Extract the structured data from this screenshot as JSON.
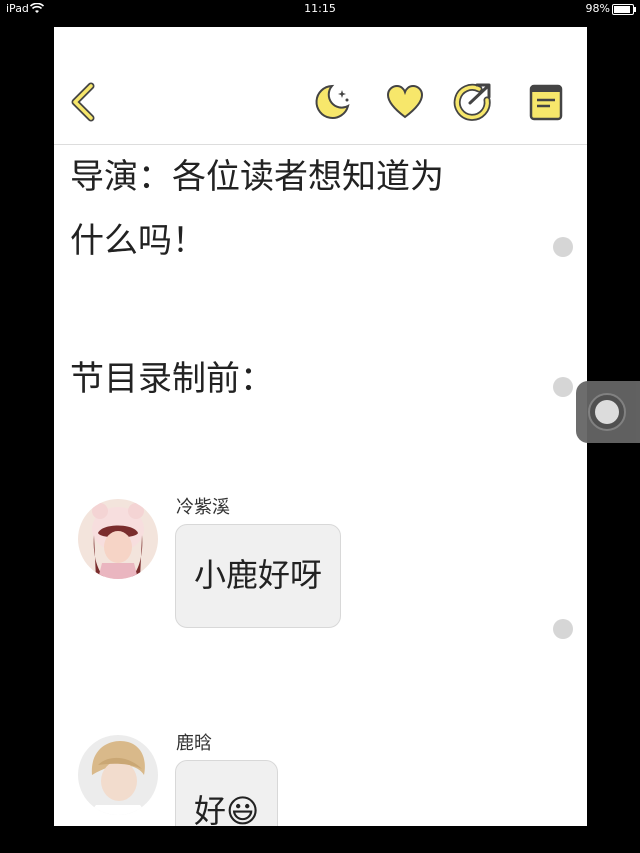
{
  "status_bar": {
    "device": "iPad",
    "time": "11:15",
    "battery": "98%"
  },
  "toolbar": {
    "back_icon": "chevron-left-icon",
    "night_icon": "moon-icon",
    "favorite_icon": "heart-icon",
    "share_icon": "refresh-arrow-icon",
    "catalog_icon": "book-icon",
    "accent_color": "#f7e76b",
    "outline_color": "#444444"
  },
  "story": {
    "paragraphs": [
      "导演：各位读者想知道为",
      "什么吗！",
      "节目录制前："
    ]
  },
  "chat": [
    {
      "sender": "冷紫溪",
      "message": "小鹿好呀",
      "avatar": "avatar-pink-hoodie-girl"
    },
    {
      "sender": "鹿晗",
      "message": "好😃",
      "avatar": "avatar-blonde-boy"
    }
  ]
}
